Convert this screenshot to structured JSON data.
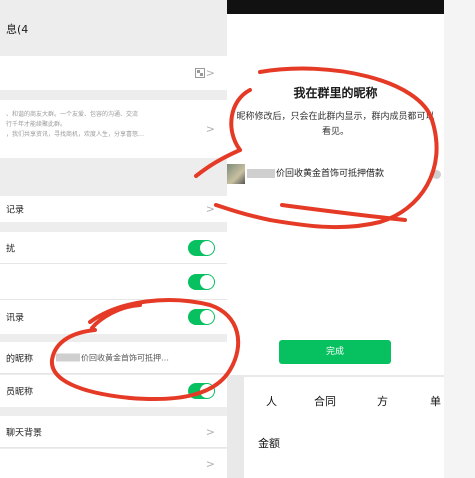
{
  "left": {
    "title": "息(4",
    "group_desc": "、和谐的商友大群。一个友爱、包容的沟通、交流\n行千年才能续聚此群。\n，我们共享资讯，寻找商机，欢度人生，分享喜怒…",
    "items": [
      {
        "label": "记录"
      },
      {
        "label": "扰"
      },
      {
        "label": "讯录"
      }
    ],
    "nickname": {
      "label": "的昵称",
      "value": "价回收黄金首饰可抵押…"
    },
    "show_member_nickname": {
      "label": "员昵称"
    },
    "chat_background": {
      "label": "聊天背景"
    }
  },
  "right": {
    "title": "我在群里的昵称",
    "description_line1": "昵称修改后，只会在此群内显示，群内成员都可以",
    "description_line2": "看见。",
    "input_value": "价回收黄金首饰可抵押借款",
    "done_label": "完成",
    "doc_words": [
      "人",
      "合同",
      "方",
      "单"
    ],
    "doc_amount": "金额"
  },
  "colors": {
    "accent": "#07c160",
    "annotation": "#e43a26"
  },
  "icons": [
    "chevron-right-icon",
    "qr-code-icon",
    "clear-icon"
  ]
}
